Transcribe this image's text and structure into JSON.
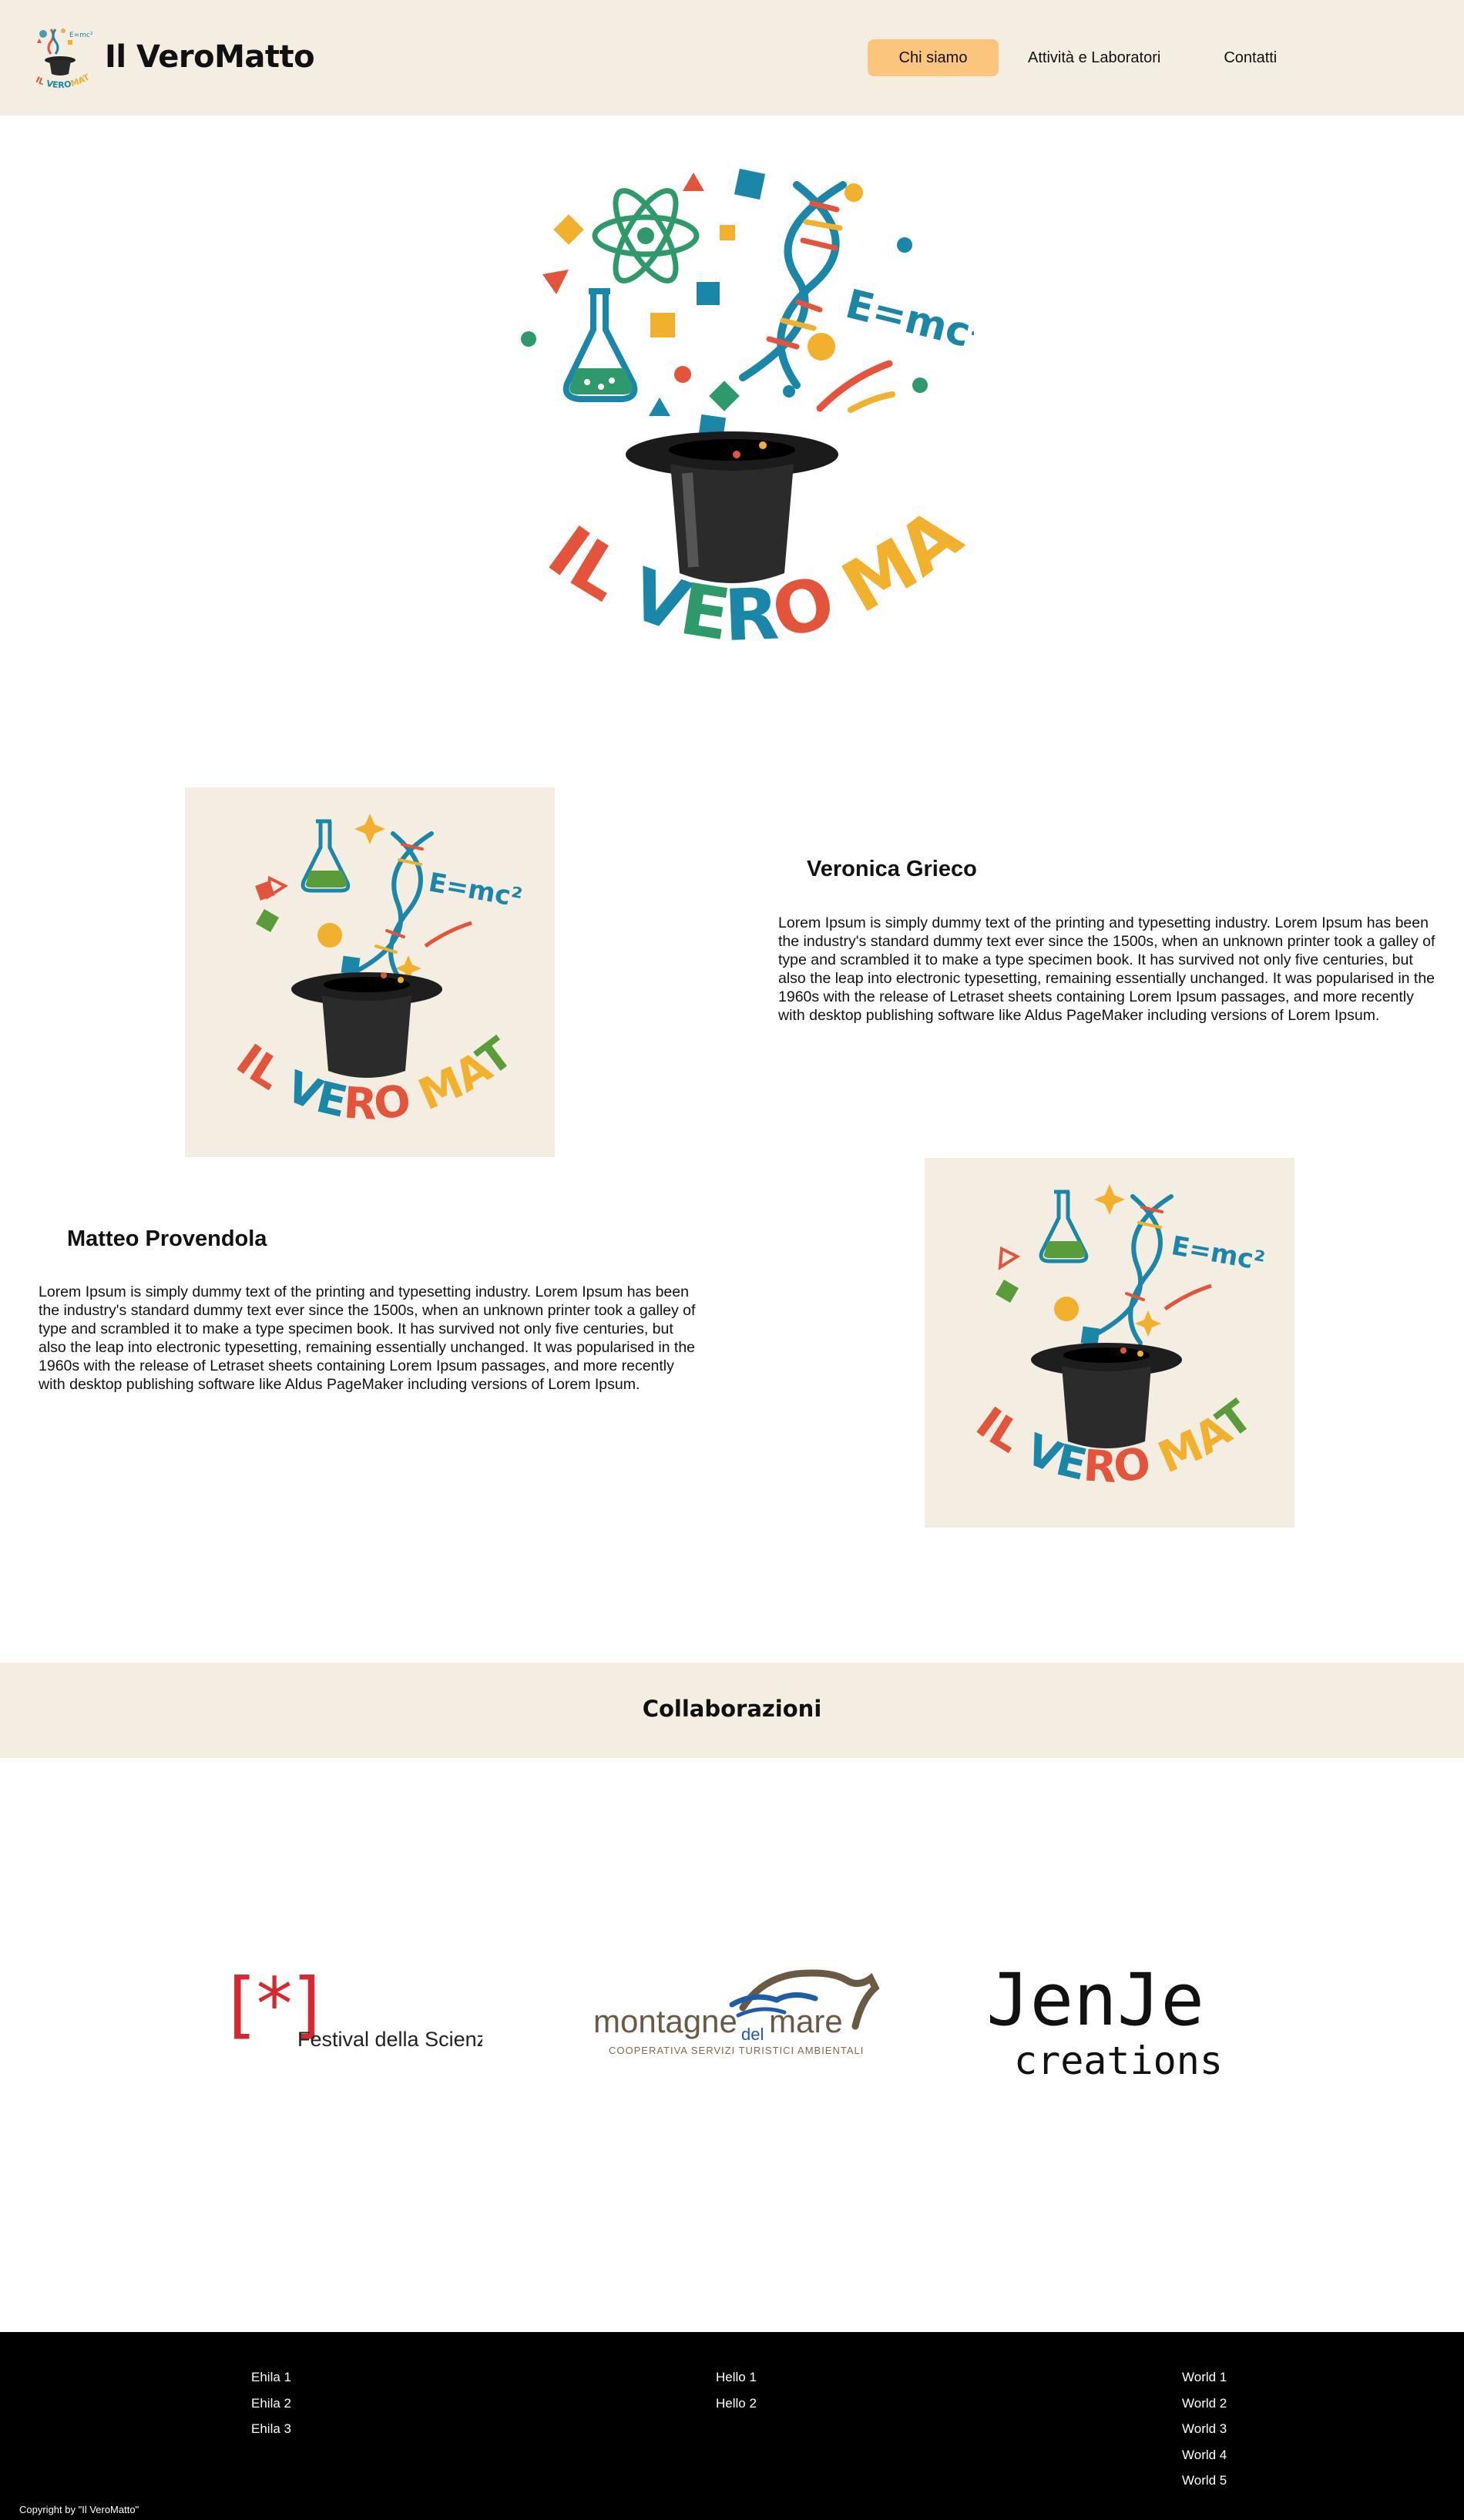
{
  "header": {
    "brand_title": "Il VeroMatto",
    "nav": [
      {
        "label": "Chi siamo",
        "active": true
      },
      {
        "label": "Attività e Laboratori",
        "active": false
      },
      {
        "label": "Contatti",
        "active": false
      }
    ]
  },
  "logo": {
    "words": [
      "IL",
      "VERO",
      "MATTO"
    ],
    "formula": "E=mc²"
  },
  "team": [
    {
      "name": "Veronica Grieco",
      "bio": "Lorem Ipsum is simply dummy text of the printing and typesetting industry. Lorem Ipsum has been the industry's standard dummy text ever since the 1500s, when an unknown printer took a galley of type and scrambled it to make a type specimen book. It has survived not only five centuries, but also the leap into electronic typesetting, remaining essentially unchanged. It was popularised in the 1960s with the release of Letraset sheets containing Lorem Ipsum passages, and more recently with desktop publishing software like Aldus PageMaker including versions of Lorem Ipsum."
    },
    {
      "name": "Matteo Provendola",
      "bio": "Lorem Ipsum is simply dummy text of the printing and typesetting industry. Lorem Ipsum has been the industry's standard dummy text ever since the 1500s, when an unknown printer took a galley of type and scrambled it to make a type specimen book. It has survived not only five centuries, but also the leap into electronic typesetting, remaining essentially unchanged. It was popularised in the 1960s with the release of Letraset sheets containing Lorem Ipsum passages, and more recently with desktop publishing software like Aldus PageMaker including versions of Lorem Ipsum."
    }
  ],
  "collaborations": {
    "title": "Collaborazioni",
    "partners": [
      {
        "name": "Festival della Scienza",
        "mark": "[*]"
      },
      {
        "name": "montagne del mare",
        "word1": "montagne",
        "word2": "del",
        "word3": "mare",
        "tagline": "COOPERATIVA SERVIZI TURISTICI AMBIENTALI"
      },
      {
        "name": "JenJe creations",
        "word1": "JenJe",
        "word2": "creations"
      }
    ]
  },
  "footer": {
    "col1": [
      "Ehila 1",
      "Ehila 2",
      "Ehila 3"
    ],
    "col2": [
      "Hello 1",
      "Hello 2"
    ],
    "col3": [
      "World 1",
      "World 2",
      "World 3",
      "World 4",
      "World 5"
    ],
    "copyright": "Copyright by \"Il VeroMatto\""
  },
  "colors": {
    "header_bg": "#f4ede2",
    "nav_active": "#fbc57e",
    "footer_bg": "#000000",
    "red": "#e4543a",
    "teal": "#1a87a8",
    "green": "#2e9a6c",
    "yellow": "#f2b12c"
  }
}
